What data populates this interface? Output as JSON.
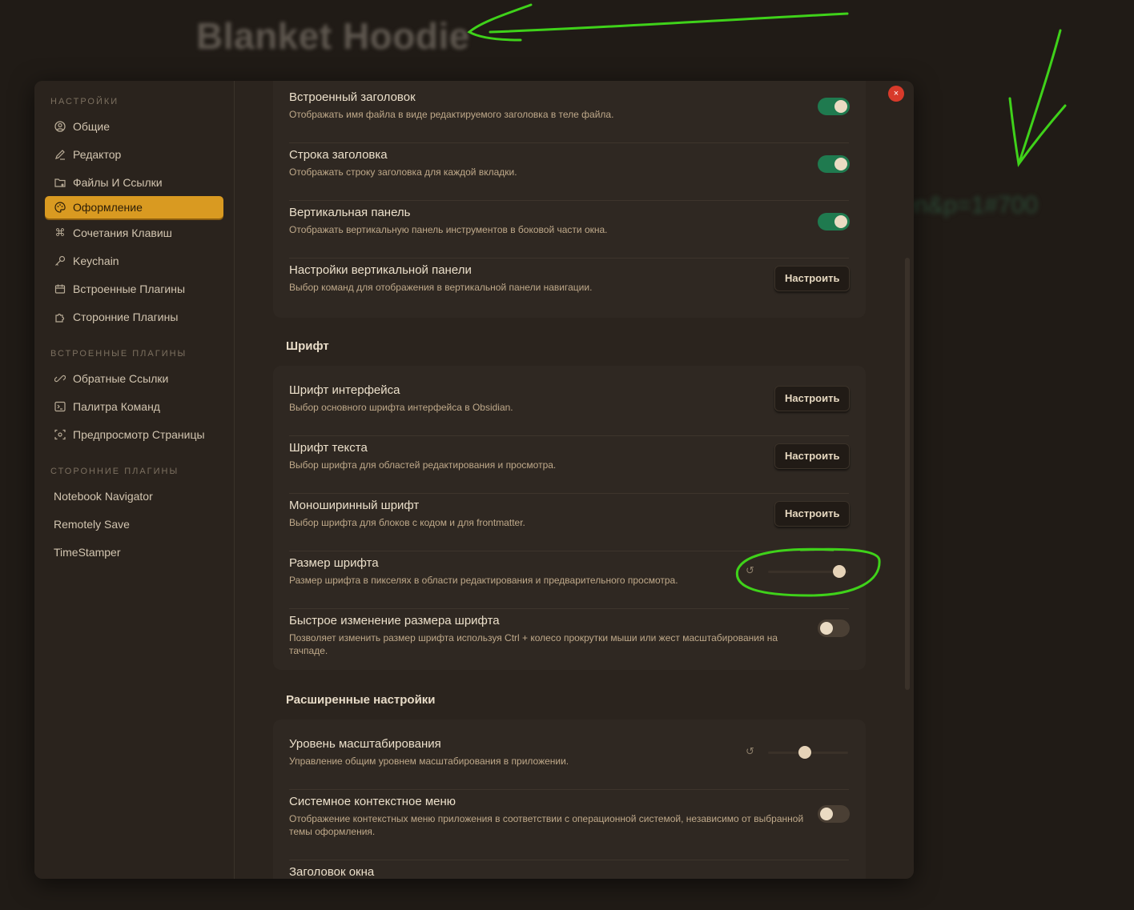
{
  "background": {
    "title": "Blanket Hoodie",
    "url_fragment": "en&p=1#700"
  },
  "sidebar": {
    "sections": [
      {
        "label": "НАСТРОЙКИ",
        "items": [
          {
            "label": "Общие",
            "icon": "user-circle-icon"
          },
          {
            "label": "Редактор",
            "icon": "pencil-icon"
          },
          {
            "label": "Файлы И Ссылки",
            "icon": "folder-link-icon"
          },
          {
            "label": "Оформление",
            "icon": "palette-icon",
            "active": true
          },
          {
            "label": "Сочетания Клавиш",
            "icon": "command-icon"
          },
          {
            "label": "Keychain",
            "icon": "key-icon"
          },
          {
            "label": "Встроенные Плагины",
            "icon": "calendar-icon"
          },
          {
            "label": "Сторонние Плагины",
            "icon": "puzzle-icon"
          }
        ]
      },
      {
        "label": "ВСТРОЕННЫЕ ПЛАГИНЫ",
        "items": [
          {
            "label": "Обратные Ссылки",
            "icon": "backlink-icon"
          },
          {
            "label": "Палитра Команд",
            "icon": "terminal-icon"
          },
          {
            "label": "Предпросмотр Страницы",
            "icon": "scan-eye-icon"
          }
        ]
      },
      {
        "label": "СТОРОННИЕ ПЛАГИНЫ",
        "items": [
          {
            "label": "Notebook Navigator"
          },
          {
            "label": "Remotely Save"
          },
          {
            "label": "TimeStamper"
          }
        ]
      }
    ]
  },
  "settings": {
    "inline_title": {
      "title": "Встроенный заголовок",
      "desc": "Отображать имя файла в виде редактируемого заголовка в теле файла.",
      "enabled": true
    },
    "tab_title_bar": {
      "title": "Строка заголовка",
      "desc": "Отображать строку заголовка для каждой вкладки.",
      "enabled": true
    },
    "ribbon": {
      "title": "Вертикальная панель",
      "desc": "Отображать вертикальную панель инструментов в боковой части окна.",
      "enabled": true
    },
    "ribbon_config": {
      "title": "Настройки вертикальной панели",
      "desc": "Выбор команд для отображения в вертикальной панели навигации.",
      "button": "Настроить"
    },
    "font_section": "Шрифт",
    "interface_font": {
      "title": "Шрифт интерфейса",
      "desc": "Выбор основного шрифта интерфейса в Obsidian.",
      "button": "Настроить"
    },
    "text_font": {
      "title": "Шрифт текста",
      "desc": "Выбор шрифта для областей редактирования и просмотра.",
      "button": "Настроить"
    },
    "mono_font": {
      "title": "Моноширинный шрифт",
      "desc": "Выбор шрифта для блоков с кодом и для frontmatter.",
      "button": "Настроить"
    },
    "font_size": {
      "title": "Размер шрифта",
      "desc": "Размер шрифта в пикселях в области редактирования и предварительного просмотра.",
      "value": 0.96
    },
    "quick_font_size": {
      "title": "Быстрое изменение размера шрифта",
      "desc": "Позволяет изменить размер шрифта используя Ctrl + колесо прокрутки мыши или жест масштабирования на тачпаде.",
      "enabled": false
    },
    "advanced_section": "Расширенные настройки",
    "zoom_level": {
      "title": "Уровень масштабирования",
      "desc": "Управление общим уровнем масштабирования в приложении.",
      "value": 0.45
    },
    "native_menus": {
      "title": "Системное контекстное меню",
      "desc": "Отображение контекстных меню приложения в соответствии с операционной системой, независимо от выбранной темы оформления.",
      "enabled": false
    },
    "window_frame": {
      "title": "Заголовок окна"
    }
  },
  "close_label": "×"
}
